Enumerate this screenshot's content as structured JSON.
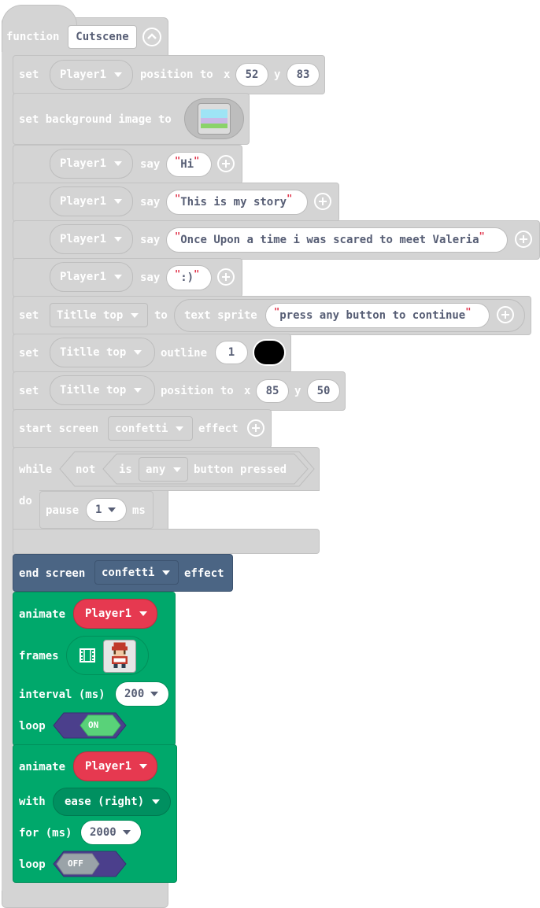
{
  "function_block": {
    "keyword": "function",
    "name": "Cutscene",
    "collapse_icon": "chevron-up-icon"
  },
  "statements": {
    "set_position_1": {
      "set": "set",
      "sprite": "Player1",
      "position_to": "position to",
      "x_label": "x",
      "x": "52",
      "y_label": "y",
      "y": "83"
    },
    "set_background": {
      "label": "set background image to",
      "image_icon": "landscape-image-icon"
    },
    "say_1": {
      "sprite": "Player1",
      "say": "say",
      "text": "Hi"
    },
    "say_2": {
      "sprite": "Player1",
      "say": "say",
      "text": "This is my story"
    },
    "say_3": {
      "sprite": "Player1",
      "say": "say",
      "text": "Once Upon a time i was scared to meet Valeria"
    },
    "say_4": {
      "sprite": "Player1",
      "say": "say",
      "text": ":)"
    },
    "set_text_sprite": {
      "set": "set",
      "var": "Titlle top",
      "to": "to",
      "text_sprite": "text sprite",
      "text": "press any button to continue"
    },
    "set_outline": {
      "set": "set",
      "sprite": "Titlle top",
      "outline": "outline",
      "width": "1",
      "color": "#000000"
    },
    "set_position_2": {
      "set": "set",
      "sprite": "Titlle top",
      "position_to": "position to",
      "x_label": "x",
      "x": "85",
      "y_label": "y",
      "y": "50"
    },
    "start_effect": {
      "start": "start screen",
      "effect": "confetti",
      "suffix": "effect"
    },
    "while_loop": {
      "while": "while",
      "not": "not",
      "is": "is",
      "button": "any",
      "pressed": "button pressed",
      "do": "do",
      "pause": "pause",
      "ms_value": "1",
      "ms": "ms"
    },
    "end_effect": {
      "end": "end screen",
      "effect": "confetti",
      "suffix": "effect"
    },
    "animate_frames": {
      "animate": "animate",
      "sprite": "Player1",
      "frames": "frames",
      "frames_icon": "film-icon",
      "interval_label": "interval (ms)",
      "interval": "200",
      "loop": "loop",
      "loop_state": "ON"
    },
    "animate_motion": {
      "animate": "animate",
      "sprite": "Player1",
      "with": "with",
      "motion": "ease (right)",
      "for_label": "for (ms)",
      "duration": "2000",
      "loop": "loop",
      "loop_state": "OFF"
    }
  },
  "colors": {
    "grey": "#d4d4d4",
    "dark_blue": "#4b6584",
    "green": "#00a86b",
    "red": "#e63950",
    "purple": "#4b3f8c",
    "toggle_on": "#59d279",
    "toggle_off": "#9aa3a8"
  }
}
